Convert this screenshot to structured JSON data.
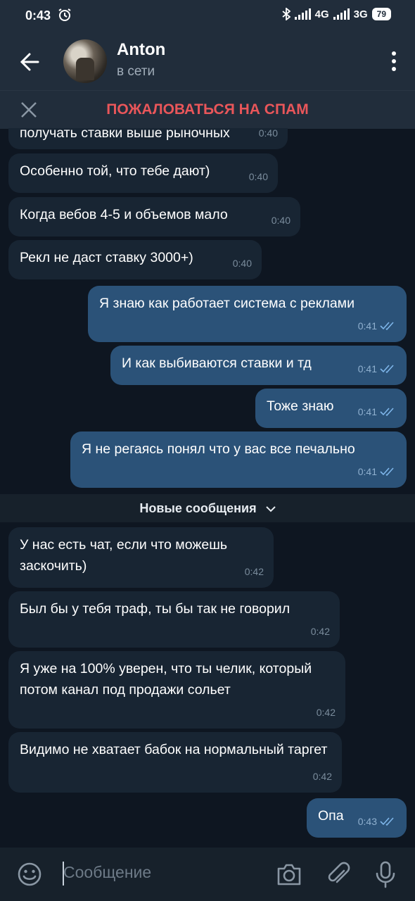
{
  "status_bar": {
    "time": "0:43",
    "net1": "4G",
    "net2": "3G",
    "battery": "79"
  },
  "header": {
    "name": "Anton",
    "status": "в сети"
  },
  "spam_bar": {
    "label": "ПОЖАЛОВАТЬСЯ НА СПАМ"
  },
  "messages": [
    {
      "dir": "in",
      "text": "получать ставки выше рыночных",
      "time": "0:40"
    },
    {
      "dir": "in",
      "text": "Особенно той, что тебе дают)",
      "time": "0:40"
    },
    {
      "dir": "in",
      "text": "Когда вебов 4-5 и объемов мало",
      "time": "0:40"
    },
    {
      "dir": "in",
      "text": "Рекл не даст ставку 3000+)",
      "time": "0:40"
    },
    {
      "dir": "out",
      "text": "Я знаю как работает система с реклами",
      "time": "0:41"
    },
    {
      "dir": "out",
      "text": "И как выбиваются ставки и тд",
      "time": "0:41"
    },
    {
      "dir": "out",
      "text": "Тоже знаю",
      "time": "0:41"
    },
    {
      "dir": "out",
      "text": "Я не регаясь понял что у вас все печально",
      "time": "0:41"
    },
    {
      "dir": "in",
      "text": "У нас есть чат, если что можешь заскочить)",
      "time": "0:42"
    },
    {
      "dir": "in",
      "text": "Был бы у тебя траф, ты бы так не говорил",
      "time": "0:42"
    },
    {
      "dir": "in",
      "text": "Я уже на 100% уверен, что ты челик, который потом канал под продажи сольет",
      "time": "0:42"
    },
    {
      "dir": "in",
      "text": "Видимо не хватает бабок на нормальный таргет",
      "time": "0:42"
    },
    {
      "dir": "out",
      "text": "Опа",
      "time": "0:43"
    }
  ],
  "new_messages_label": "Новые сообщения",
  "input": {
    "placeholder": "Сообщение"
  }
}
